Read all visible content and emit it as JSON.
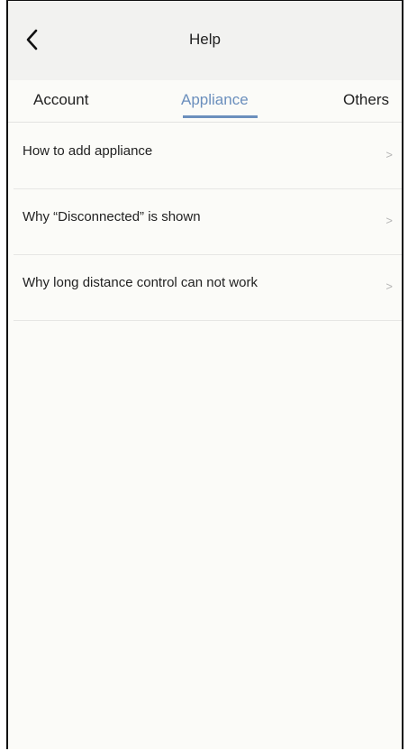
{
  "header": {
    "title": "Help",
    "back_icon": "chevron-left-icon"
  },
  "tabs": [
    {
      "label": "Account",
      "active": false
    },
    {
      "label": "Appliance",
      "active": true
    },
    {
      "label": "Others",
      "active": false
    }
  ],
  "accent_color": "#6b8fbd",
  "list": {
    "items": [
      {
        "label": "How to add appliance",
        "chevron": ">"
      },
      {
        "label": "Why “Disconnected” is shown",
        "chevron": ">"
      },
      {
        "label": "Why long distance control can not work",
        "chevron": ">"
      }
    ]
  }
}
